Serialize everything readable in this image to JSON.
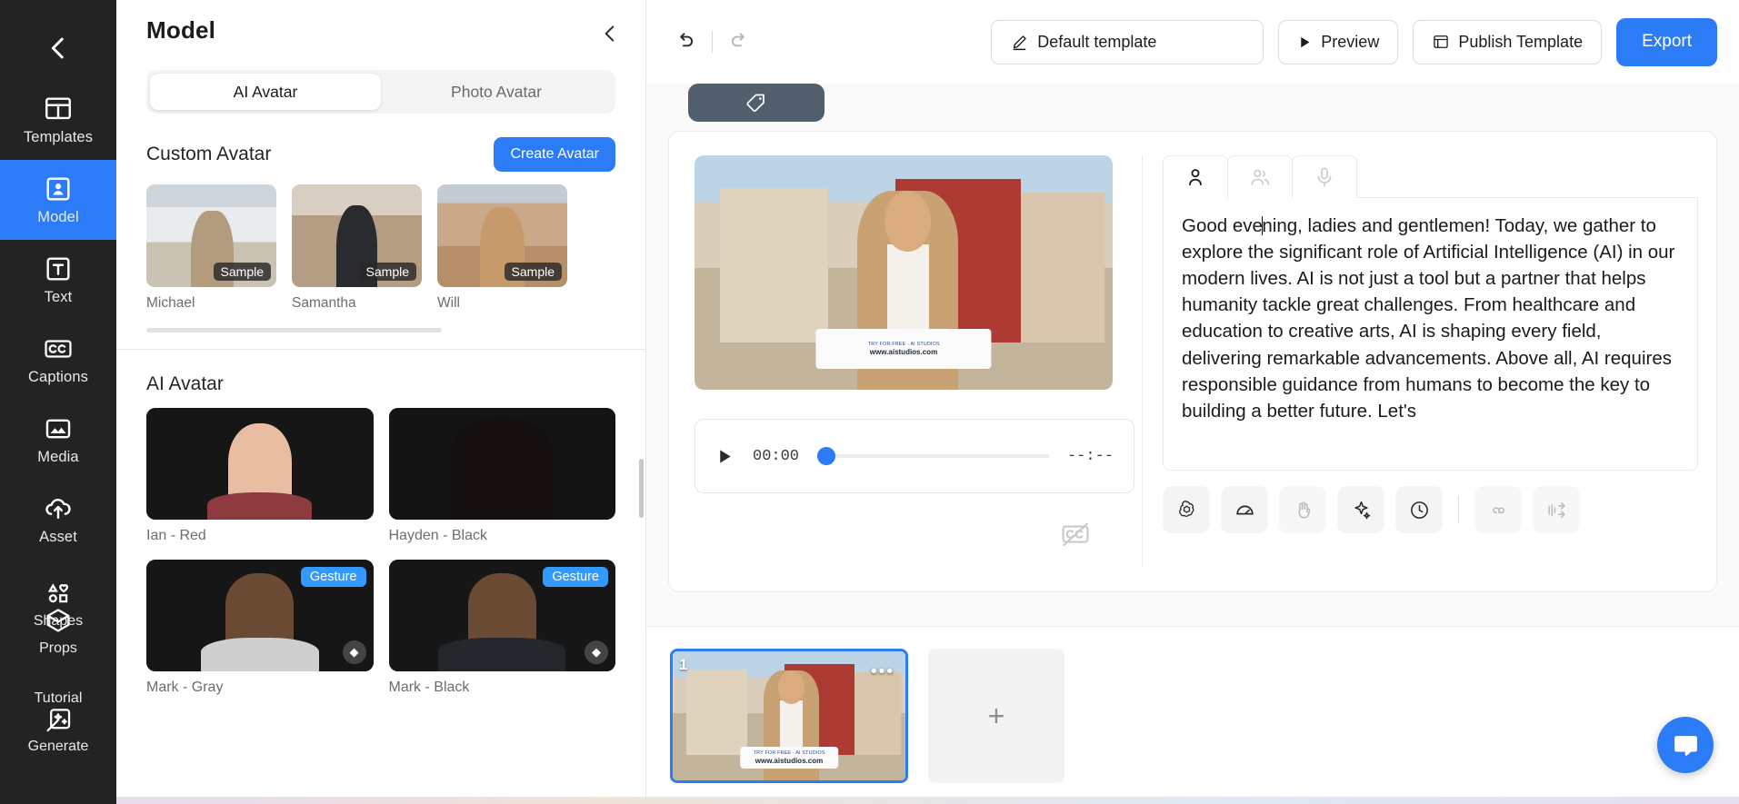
{
  "rail": {
    "back_icon": "chevron-left-icon",
    "items": [
      {
        "label": "Templates",
        "icon": "templates-icon",
        "active": false
      },
      {
        "label": "Model",
        "icon": "model-person-icon",
        "active": true
      },
      {
        "label": "Text",
        "icon": "text-t-icon",
        "active": false
      },
      {
        "label": "Captions",
        "icon": "captions-cc-icon",
        "active": false
      },
      {
        "label": "Media",
        "icon": "media-image-icon",
        "active": false
      },
      {
        "label": "Asset",
        "icon": "asset-cloud-upload-icon",
        "active": false
      },
      {
        "label": "Shapes",
        "icon": "shapes-icon",
        "active": false
      },
      {
        "label": "Props",
        "icon": "props-cube-icon",
        "active": false
      },
      {
        "label": "Tutorial",
        "icon": "tutorial-icon",
        "active": false
      },
      {
        "label": "Generate",
        "icon": "generate-wand-icon",
        "active": false
      }
    ]
  },
  "panel": {
    "title": "Model",
    "collapse_icon": "chevron-left-icon",
    "tabs": [
      {
        "label": "AI Avatar",
        "active": true
      },
      {
        "label": "Photo Avatar",
        "active": false
      }
    ],
    "custom": {
      "title": "Custom Avatar",
      "create_button": "Create Avatar",
      "badge": "Sample",
      "items": [
        {
          "name": "Michael",
          "photo": "ph-michael",
          "badge": true
        },
        {
          "name": "Samantha",
          "photo": "ph-samantha",
          "badge": true
        },
        {
          "name": "Will",
          "photo": "ph-will",
          "badge": true
        }
      ]
    },
    "ai": {
      "title": "AI Avatar",
      "gesture_badge": "Gesture",
      "items": [
        {
          "name": "Ian - Red",
          "photo": "ph-ian",
          "gesture": false,
          "diamond": false
        },
        {
          "name": "Hayden - Black",
          "photo": "ph-hayden",
          "gesture": false,
          "diamond": false
        },
        {
          "name": "Mark - Gray",
          "photo": "ph-markg",
          "gesture": true,
          "diamond": true
        },
        {
          "name": "Mark - Black",
          "photo": "ph-markb",
          "gesture": true,
          "diamond": true
        }
      ]
    }
  },
  "toolbar": {
    "undo_icon": "undo-icon",
    "redo_icon": "redo-icon",
    "template_label": "Default template",
    "template_icon": "pencil-edit-icon",
    "preview_label": "Preview",
    "preview_icon": "play-triangle-icon",
    "publish_label": "Publish Template",
    "publish_icon": "window-publish-icon",
    "export_label": "Export"
  },
  "stage": {
    "tag_icon": "tag-label-icon",
    "player": {
      "play_icon": "play-triangle-icon",
      "current_time": "00:00",
      "total_time": "--:--",
      "progress_percent": 0
    },
    "captions_off_icon": "captions-off-icon",
    "video_overlay": {
      "line1": "TRY FOR FREE · AI STUDIOS",
      "line2": "www.aistudios.com"
    }
  },
  "script_panel": {
    "tabs": [
      {
        "icon": "person-single-icon",
        "active": true
      },
      {
        "icon": "person-group-icon",
        "active": false
      },
      {
        "icon": "microphone-icon",
        "active": false
      }
    ],
    "text_before_caret": "Good eve",
    "text_after_caret": "ning, ladies and gentlemen! Today, we gather to explore the significant role of Artificial Intelligence (AI) in our modern lives. AI is not just a tool but a partner that helps humanity tackle great challenges. From healthcare and education to creative arts, AI is shaping every field, delivering remarkable advancements. Above all, AI requires responsible guidance from humans to become the key to building a better future. Let's",
    "tools": [
      {
        "icon": "chatgpt-flower-icon",
        "muted": false
      },
      {
        "icon": "speed-gauge-icon",
        "muted": false
      },
      {
        "icon": "waving-hand-gesture-icon",
        "muted": true
      },
      {
        "icon": "sparkle-ai-icon",
        "muted": false
      },
      {
        "icon": "clock-pause-icon",
        "muted": false
      },
      {
        "icon": "pronunciation-icon",
        "muted": true
      },
      {
        "icon": "speech-break-icon",
        "muted": true
      }
    ]
  },
  "timeline": {
    "scene_number": "1",
    "scene_menu_icon": "more-dots-icon",
    "add_scene_icon": "plus-icon"
  },
  "chat_widget": {
    "icon": "intercom-chat-icon"
  },
  "colors": {
    "accent": "#2b7cf6",
    "rail_bg": "#232323",
    "gesture_badge": "#3399ff",
    "canvas_bg": "#fafafa"
  }
}
